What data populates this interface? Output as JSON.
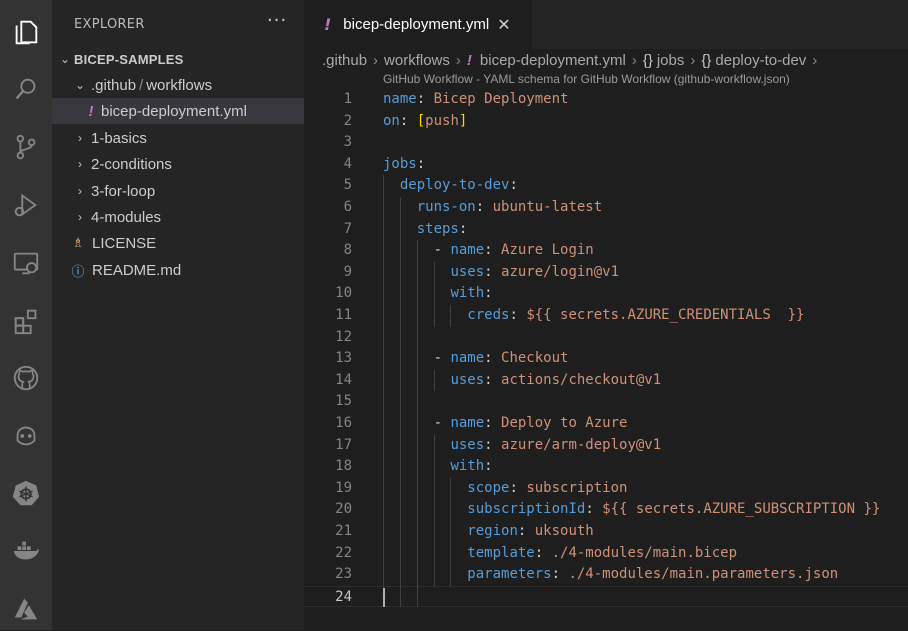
{
  "activity_bar": {
    "items": [
      {
        "icon": "files-icon"
      },
      {
        "icon": "search-icon"
      },
      {
        "icon": "source-control-icon"
      },
      {
        "icon": "run-debug-icon"
      },
      {
        "icon": "remote-explorer-icon"
      },
      {
        "icon": "extensions-icon"
      },
      {
        "icon": "github-icon"
      },
      {
        "icon": "copilot-icon"
      },
      {
        "icon": "kubernetes-icon"
      },
      {
        "icon": "docker-icon"
      },
      {
        "icon": "azure-icon"
      }
    ]
  },
  "sidebar": {
    "title": "EXPLORER",
    "more": "···",
    "workspace": "BICEP-SAMPLES",
    "tree": [
      {
        "label_a": ".github",
        "sep": "/",
        "label_b": "workflows"
      },
      {
        "label": "bicep-deployment.yml",
        "file_icon": "!"
      },
      {
        "label": "1-basics"
      },
      {
        "label": "2-conditions"
      },
      {
        "label": "3-for-loop"
      },
      {
        "label": "4-modules"
      },
      {
        "label": "LICENSE"
      },
      {
        "label": "README.md"
      }
    ]
  },
  "tab": {
    "icon": "!",
    "label": "bicep-deployment.yml",
    "close": "✕"
  },
  "breadcrumbs": {
    "items": [
      ".github",
      "workflows",
      "bicep-deployment.yml",
      "jobs",
      "deploy-to-dev"
    ],
    "separator": "›",
    "file_icon": "!",
    "symbol_icon": "{}"
  },
  "schema_hint": "GitHub Workflow - YAML schema for GitHub Workflow (github-workflow.json)",
  "editor": {
    "lines": [
      {
        "n": "1",
        "indent": "",
        "key": "name",
        "sep": ": ",
        "val": "Bicep Deployment"
      },
      {
        "n": "2",
        "indent": "",
        "key": "on",
        "sep": ": ",
        "val": "",
        "bracket_open": "[",
        "bracket_val": "push",
        "bracket_close": "]"
      },
      {
        "n": "3",
        "indent": "",
        "key": "",
        "sep": "",
        "val": ""
      },
      {
        "n": "4",
        "indent": "",
        "key": "jobs",
        "sep": ":",
        "val": ""
      },
      {
        "n": "5",
        "indent": "  ",
        "key": "deploy-to-dev",
        "sep": ":",
        "val": ""
      },
      {
        "n": "6",
        "indent": "    ",
        "key": "runs-on",
        "sep": ": ",
        "val": "ubuntu-latest"
      },
      {
        "n": "7",
        "indent": "    ",
        "key": "steps",
        "sep": ":",
        "val": ""
      },
      {
        "n": "8",
        "indent": "      - ",
        "key": "name",
        "sep": ": ",
        "val": "Azure Login"
      },
      {
        "n": "9",
        "indent": "        ",
        "key": "uses",
        "sep": ": ",
        "val": "azure/login@v1"
      },
      {
        "n": "10",
        "indent": "        ",
        "key": "with",
        "sep": ":",
        "val": ""
      },
      {
        "n": "11",
        "indent": "          ",
        "key": "creds",
        "sep": ": ",
        "val": "${{ secrets.AZURE_CREDENTIALS  }}"
      },
      {
        "n": "12",
        "indent": "",
        "key": "",
        "sep": "",
        "val": ""
      },
      {
        "n": "13",
        "indent": "      - ",
        "key": "name",
        "sep": ": ",
        "val": "Checkout"
      },
      {
        "n": "14",
        "indent": "        ",
        "key": "uses",
        "sep": ": ",
        "val": "actions/checkout@v1"
      },
      {
        "n": "15",
        "indent": "",
        "key": "",
        "sep": "",
        "val": ""
      },
      {
        "n": "16",
        "indent": "      - ",
        "key": "name",
        "sep": ": ",
        "val": "Deploy to Azure"
      },
      {
        "n": "17",
        "indent": "        ",
        "key": "uses",
        "sep": ": ",
        "val": "azure/arm-deploy@v1"
      },
      {
        "n": "18",
        "indent": "        ",
        "key": "with",
        "sep": ":",
        "val": ""
      },
      {
        "n": "19",
        "indent": "          ",
        "key": "scope",
        "sep": ": ",
        "val": "subscription"
      },
      {
        "n": "20",
        "indent": "          ",
        "key": "subscriptionId",
        "sep": ": ",
        "val": "${{ secrets.AZURE_SUBSCRIPTION }}"
      },
      {
        "n": "21",
        "indent": "          ",
        "key": "region",
        "sep": ": ",
        "val": "uksouth"
      },
      {
        "n": "22",
        "indent": "          ",
        "key": "template",
        "sep": ": ",
        "val": "./4-modules/main.bicep"
      },
      {
        "n": "23",
        "indent": "          ",
        "key": "parameters",
        "sep": ": ",
        "val": "./4-modules/main.parameters.json"
      },
      {
        "n": "24",
        "indent": "",
        "key": "",
        "sep": "",
        "val": ""
      }
    ]
  },
  "colors": {
    "yaml_key": "#569cd6",
    "yaml_value": "#ce9178",
    "bracket": "#ffd700",
    "yaml_file_icon": "#cc6fc7",
    "license_icon": "#d7ba7d",
    "info_icon": "#75beff"
  }
}
